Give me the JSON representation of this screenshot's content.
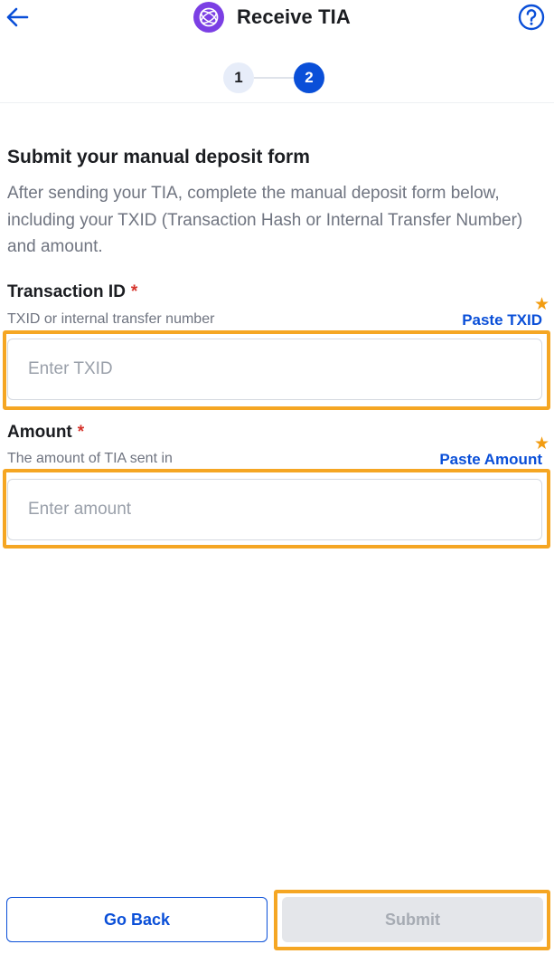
{
  "header": {
    "title": "Receive TIA",
    "back_icon": "arrow-left-icon",
    "coin_icon": "celestia-tia-logo-icon",
    "help_icon": "question-circle-icon",
    "accent_color": "#0a4fd8",
    "coin_color": "#7b3fe4"
  },
  "stepper": {
    "steps": [
      "1",
      "2"
    ],
    "current_step": 2
  },
  "form": {
    "title": "Submit your manual deposit form",
    "description": "After sending your TIA, complete the manual deposit form below, including your TXID (Transaction Hash or Internal Transfer Number) and amount.",
    "fields": [
      {
        "label": "Transaction ID",
        "required_mark": "*",
        "hint": "TXID or internal transfer number",
        "paste_label": "Paste TXID",
        "placeholder": "Enter TXID",
        "value": ""
      },
      {
        "label": "Amount",
        "required_mark": "*",
        "hint": "The amount of TIA sent in",
        "paste_label": "Paste Amount",
        "placeholder": "Enter amount",
        "value": ""
      }
    ]
  },
  "footer": {
    "go_back_label": "Go Back",
    "submit_label": "Submit",
    "submit_disabled": true
  },
  "highlight_color": "#f5a623",
  "star_icon": "star-icon"
}
